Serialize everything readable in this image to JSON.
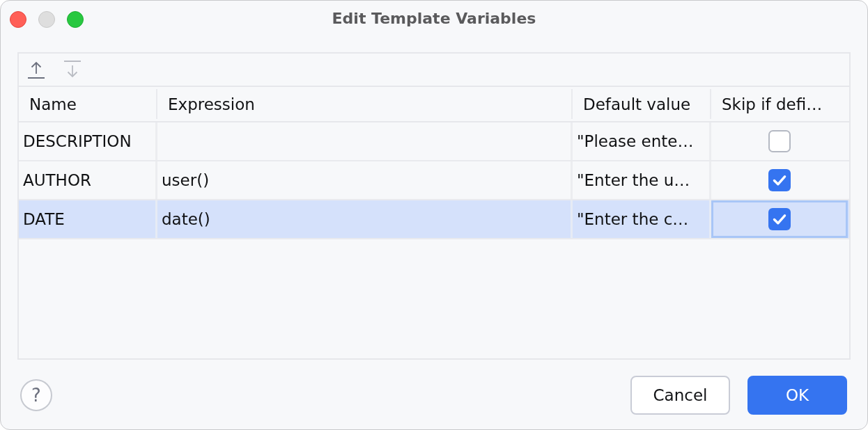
{
  "window": {
    "title": "Edit Template Variables",
    "controls": [
      {
        "kind": "close",
        "disabled": false
      },
      {
        "kind": "minimize",
        "disabled": true
      },
      {
        "kind": "zoom",
        "disabled": false
      }
    ]
  },
  "toolbar": [
    {
      "kind": "move_up",
      "disabled": false
    },
    {
      "kind": "move_down",
      "disabled": true
    }
  ],
  "table": {
    "columns": [
      "Name",
      "Expression",
      "Default value",
      "Skip if defi…"
    ],
    "rows": [
      {
        "name": "DESCRIPTION",
        "default_value": "\"Please ente…",
        "skip": false,
        "selected": false,
        "focused": false
      },
      {
        "name": "AUTHOR",
        "expression": "user()",
        "default_value": "\"Enter the u…",
        "skip": true,
        "selected": false,
        "focused": false
      },
      {
        "name": "DATE",
        "expression": "date()",
        "default_value": "\"Enter the c…",
        "skip": true,
        "selected": true,
        "focused": true
      }
    ]
  },
  "footer": {
    "help": "?",
    "buttons": [
      {
        "label": "Cancel",
        "default": false
      },
      {
        "label": "OK",
        "default": true
      }
    ]
  }
}
